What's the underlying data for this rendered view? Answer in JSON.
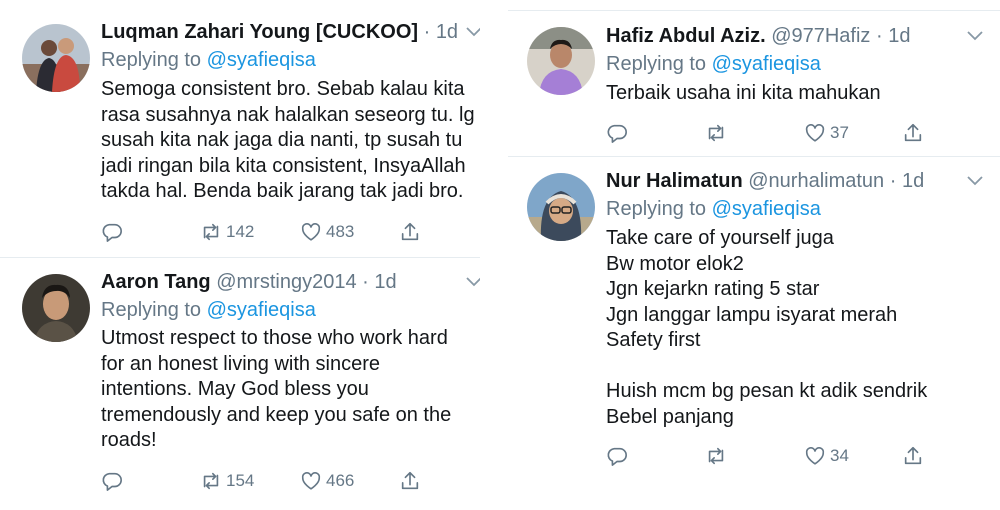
{
  "tweets": [
    {
      "name": "Luqman Zahari Young [CUCKOO]",
      "handle": "",
      "time": "1d",
      "replying_label": "Replying to",
      "replying_to": "@syafieqisa",
      "text": "Semoga consistent bro. Sebab kalau kita\nrasa susahnya nak halalkan seseorg tu. lg\nsusah kita nak jaga dia nanti, tp susah tu\njadi ringan bila kita consistent, InsyaAllah\ntakda hal. Benda baik jarang tak jadi bro.",
      "retweets": "142",
      "likes": "483",
      "avatar": "couple-photo"
    },
    {
      "name": "Aaron Tang",
      "handle": "@mrstingy2014",
      "time": "1d",
      "replying_label": "Replying to",
      "replying_to": "@syafieqisa",
      "text": "Utmost respect to those who work hard\nfor an honest living with sincere\nintentions. May God bless you\ntremendously and keep you safe on the\nroads!",
      "retweets": "154",
      "likes": "466",
      "avatar": "man-portrait"
    },
    {
      "name": "Hafiz Abdul Aziz.",
      "handle": "@977Hafiz",
      "time": "1d",
      "replying_label": "Replying to",
      "replying_to": "@syafieqisa",
      "text": "Terbaik usaha ini kita mahukan",
      "retweets": "",
      "likes": "37",
      "avatar": "man-purple-shirt"
    },
    {
      "name": "Nur Halimatun",
      "handle": "@nurhalimatun",
      "time": "1d",
      "replying_label": "Replying to",
      "replying_to": "@syafieqisa",
      "text": "Take care of yourself juga\nBw motor elok2\nJgn kejarkn rating 5 star\nJgn langgar lampu isyarat merah\nSafety first\n\nHuish mcm bg pesan kt adik sendrik\nBebel panjang",
      "retweets": "",
      "likes": "34",
      "avatar": "woman-hijab-glasses"
    }
  ],
  "colors": {
    "link": "#1b95e0",
    "muted": "#657786",
    "text": "#14171a",
    "divider": "#e6ecf0"
  },
  "icons": [
    "reply-icon",
    "retweet-icon",
    "like-icon",
    "share-icon",
    "chevron-down-icon"
  ]
}
